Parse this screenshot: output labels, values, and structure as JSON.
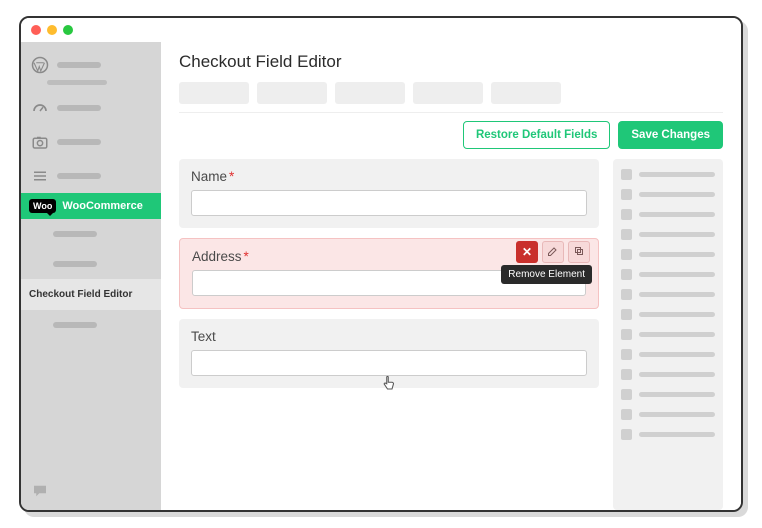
{
  "sidebar": {
    "woo_badge": "Woo",
    "woo_label": "WooCommerce",
    "selected_label": "Checkout Field Editor"
  },
  "page": {
    "title": "Checkout Field Editor"
  },
  "actions": {
    "restore": "Restore Default Fields",
    "save": "Save Changes"
  },
  "fields": [
    {
      "label": "Name",
      "required": true,
      "required_mark": "*"
    },
    {
      "label": "Address",
      "required": true,
      "required_mark": "*"
    },
    {
      "label": "Text",
      "required": false,
      "required_mark": ""
    }
  ],
  "tooltip": {
    "remove": "Remove Element"
  }
}
